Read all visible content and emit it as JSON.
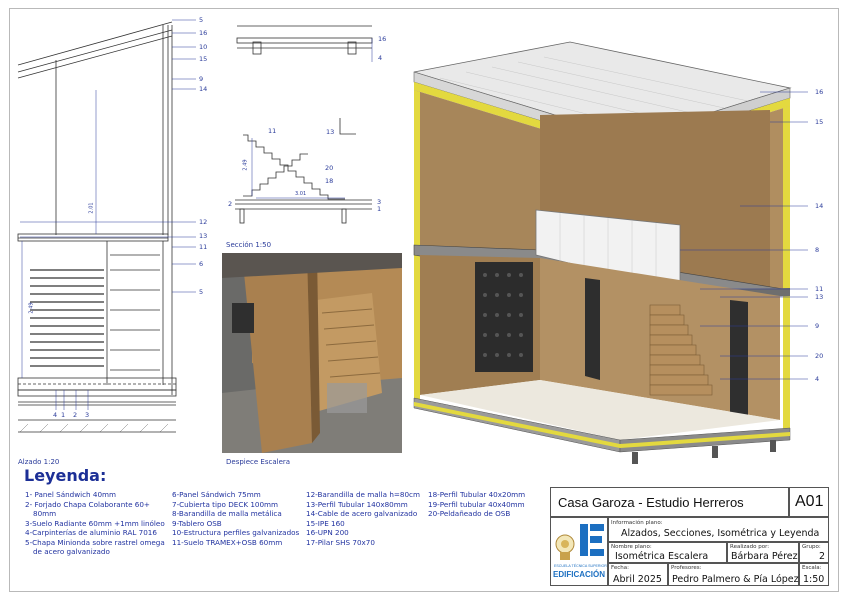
{
  "drawings": {
    "alzado_caption": "Alzado 1:20",
    "seccion_caption": "Sección 1:50",
    "despiece_caption": "Despiece Escalera",
    "alzado_callouts_right": [
      "5",
      "16",
      "10",
      "15",
      "9",
      "14",
      "12",
      "13",
      "11",
      "6",
      "5"
    ],
    "alzado_callouts_bottom": [
      "4",
      "1",
      "2",
      "3"
    ],
    "alzado_dims": [
      "2.01",
      "2.49"
    ],
    "seccion_top_callouts": [
      "16",
      "4"
    ],
    "seccion_callouts": [
      "11",
      "13",
      "20",
      "18",
      "3",
      "1",
      "2"
    ],
    "seccion_dims": [
      "2.49",
      "3.01"
    ],
    "iso_callouts": [
      "16",
      "15",
      "14",
      "8",
      "11",
      "13",
      "9",
      "20",
      "4"
    ]
  },
  "legend": {
    "title": "Leyenda:",
    "col1": [
      "1- Panel Sándwich 40mm",
      "2- Forjado Chapa Colaborante 60+",
      "80mm",
      "3-Suelo Radiante 60mm +1mm linóleo",
      "4-Carpinterías de aluminio RAL 7016",
      "5-Chapa Minionda sobre rastrel omega",
      "de acero galvanizado"
    ],
    "col2": [
      "6-Panel Sándwich 75mm",
      "7-Cubierta tipo DECK 100mm",
      "8-Barandilla de malla metálica",
      "9-Tablero OSB",
      "10-Estructura perfiles galvanizados",
      "11-Suelo TRAMEX+OSB 60mm"
    ],
    "col3": [
      "12-Barandilla de malla h=80cm",
      "13-Perfil Tubular 140x80mm",
      "14-Cable de acero galvanizado",
      "15-IPE 160",
      "16-UPN 200",
      "17-Pilar SHS 70x70"
    ],
    "col4": [
      "18-Perfil Tubular 40x20mm",
      "19-Perfil tubular 40x40mm",
      "20-Peldañeado de OSB"
    ]
  },
  "title_block": {
    "project": "Casa Garoza - Estudio Herreros",
    "sheet_code": "A01",
    "info_label": "Información plano:",
    "info_value": "Alzados, Secciones, Isométrica y Leyenda",
    "name_label": "Nombre plano:",
    "name_value": "Isométrica Escalera",
    "author_label": "Realizado por:",
    "author_value": "Bárbara Pérez",
    "group_label": "Grupo:",
    "group_value": "2",
    "date_label": "Fecha:",
    "date_value": "Abril 2025",
    "prof_label": "Profesores:",
    "prof_value": "Pedro Palmero & Pía López",
    "scale_label": "Escala:",
    "scale_value": "1:50",
    "school_text": "ESCUELA TÉCNICA SUPERIOR",
    "logo_word": "EDIFICACIÓN"
  },
  "colors": {
    "ink": "#1f2f8a",
    "osb": "#b8915e",
    "yellow_insulation": "#e8e04a",
    "frame": "#b9b9b9"
  }
}
